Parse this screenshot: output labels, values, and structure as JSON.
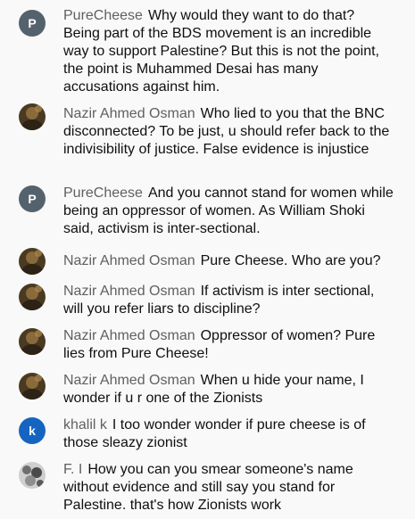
{
  "colors": {
    "avatar_p": "#54626d",
    "avatar_k": "#1565c0",
    "author_text": "#606060",
    "body_text": "#0f0f0f",
    "background": "#f9f9f9"
  },
  "comments": [
    {
      "author": "PureCheese",
      "avatar_letter": "P",
      "text": "Why would they want to do that? Being part of the BDS movement is an incredible way to support Palestine? But this is not the point, the point is Muhammed Desai has many accusations against him."
    },
    {
      "author": "Nazir Ahmed Osman",
      "avatar_icon": "profile-photo-icon",
      "text": "Who lied to you that the BNC disconnected? To be just, u should refer back to the indivisibility of justice. False evidence is injustice"
    },
    {
      "author": "PureCheese",
      "avatar_letter": "P",
      "text": "And you cannot stand for women while being an oppressor of women. As William Shoki said, activism is inter-sectional."
    },
    {
      "author": "Nazir Ahmed Osman",
      "avatar_icon": "profile-photo-icon",
      "text": "Pure Cheese. Who are you?"
    },
    {
      "author": "Nazir Ahmed Osman",
      "avatar_icon": "profile-photo-icon",
      "text": "If activism is inter sectional, will you refer liars to discipline?"
    },
    {
      "author": "Nazir Ahmed Osman",
      "avatar_icon": "profile-photo-icon",
      "text": "Oppressor of women? Pure lies from Pure Cheese!"
    },
    {
      "author": "Nazir Ahmed Osman",
      "avatar_icon": "profile-photo-icon",
      "text": "When u hide your name, I wonder if u r one of the Zionists"
    },
    {
      "author": "khalil k",
      "avatar_letter": "k",
      "text": "I too wonder wonder if pure cheese is of those sleazy zionist"
    },
    {
      "author": "F. I",
      "avatar_icon": "profile-photo-icon",
      "text": "How you can you smear someone's name without evidence and still say you stand for Palestine. that's how Zionists work"
    }
  ]
}
